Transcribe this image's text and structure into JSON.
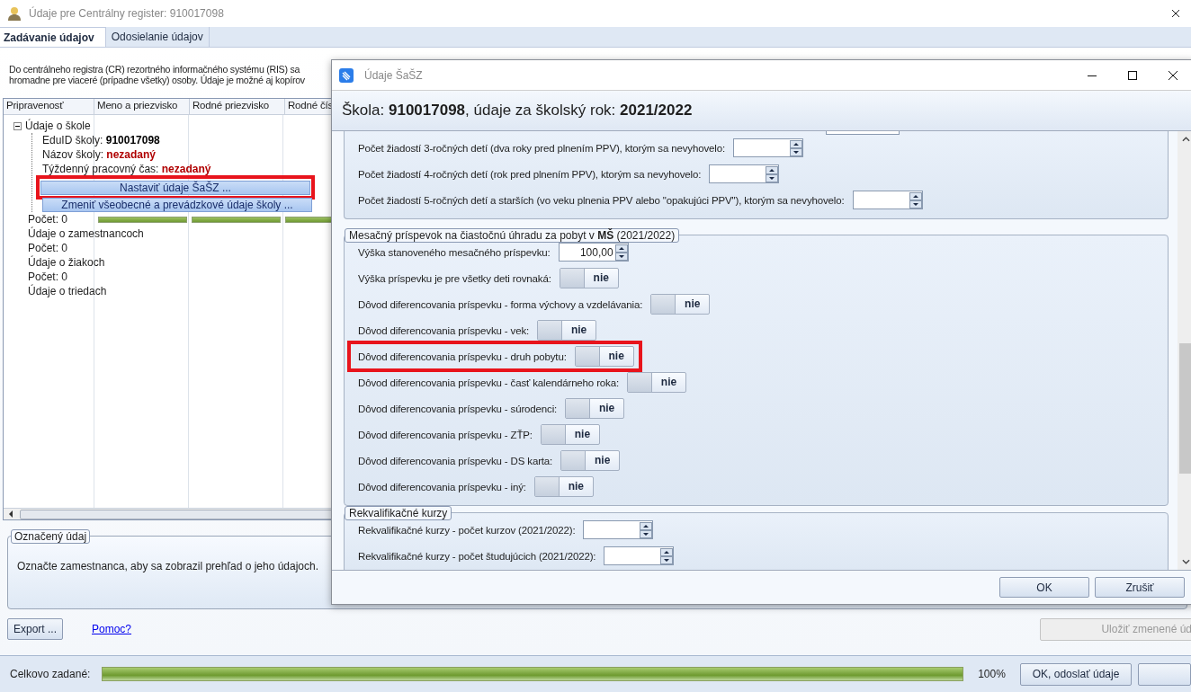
{
  "window": {
    "title": "Údaje pre Centrálny register: 910017098"
  },
  "tabs": [
    {
      "label": "Zadávanie údajov",
      "selected": true
    },
    {
      "label": "Odosielanie údajov",
      "selected": false
    }
  ],
  "description": [
    "Do centrálneho registra (CR) rezortného informačného systému (RIS) sa",
    "hromadne pre viaceré (prípadne všetky) osoby. Údaje je možné aj kopírov"
  ],
  "table": {
    "columns": [
      "Pripravenosť",
      "Meno a priezvisko",
      "Rodné priezvisko",
      "Rodné čís"
    ],
    "tree": {
      "label": "Údaje o škole",
      "expanded": true,
      "children": [
        {
          "kind": "value",
          "label": "EduID školy:",
          "value": "910017098",
          "missing": false
        },
        {
          "kind": "value",
          "label": "Názov školy:",
          "value": "nezadaný",
          "missing": true
        },
        {
          "kind": "value",
          "label": "Týždenný pracovný čas:",
          "value": "nezadaný",
          "missing": true
        },
        {
          "kind": "button",
          "label": "Nastaviť údaje ŠaŠZ ...",
          "highlighted": true
        },
        {
          "kind": "button",
          "label": "Zmeniť všeobecné a prevádzkové údaje školy ...",
          "highlighted": false
        }
      ]
    },
    "rows": [
      {
        "label": "Počet: 0",
        "bars": [
          {
            "level": 1
          },
          {
            "level": 1
          },
          {
            "level": 1
          }
        ]
      },
      {
        "label": "Údaje o zamestnancoch"
      },
      {
        "label": "Počet: 0"
      },
      {
        "label": "Údaje o žiakoch"
      },
      {
        "label": "Počet: 0"
      },
      {
        "label": "Údaje o triedach"
      }
    ]
  },
  "selected_info": {
    "title": "Označený údaj",
    "text": "Označte zamestnanca, aby sa zobrazil prehľad o jeho údajoch."
  },
  "export_button": "Export ...",
  "help_link": "Pomoc?",
  "save_button": {
    "label": "Uložiť zmenené úd",
    "disabled": true
  },
  "status_bar": {
    "label": "Celkovo zadané:",
    "level": 1,
    "reading": "100%",
    "button": "OK, odoslať údaje"
  },
  "dialog": {
    "title": "Údaje ŠaŠZ",
    "heading": "Škola: **910017098**, údaje za školský rok: **2021/2022**",
    "groups": [
      {
        "rows": [
          {
            "kind": "spinner",
            "label": "Počet žiadostí 3-ročných detí (dva roky pred plnením PPV), ktorým sa nevyhovelo:",
            "highlighted": false
          },
          {
            "kind": "spinner",
            "label": "Počet žiadostí 4-ročných detí (rok pred plnením PPV), ktorým sa nevyhovelo:",
            "highlighted": false
          },
          {
            "kind": "spinner",
            "label": "Počet žiadostí 5-ročných detí a starších (vo veku plnenia PPV alebo \"opakujúci PPV\"), ktorým sa nevyhovelo:",
            "highlighted": false
          }
        ]
      },
      {
        "legend": "Mesačný príspevok na čiastočnú úhradu za pobyt v **MŠ** (2021/2022)",
        "rows": [
          {
            "kind": "spinner",
            "label": "Výška stanoveného mesačného príspevku:",
            "value": "100,00",
            "highlighted": false
          },
          {
            "kind": "toggle",
            "label": "Výška príspevku je pre všetky deti rovnaká:",
            "on": false,
            "text": "nie",
            "highlighted": false
          },
          {
            "kind": "toggle",
            "label": "Dôvod diferencovania príspevku - forma výchovy a vzdelávania:",
            "on": false,
            "text": "nie",
            "highlighted": false
          },
          {
            "kind": "toggle",
            "label": "Dôvod diferencovania príspevku - vek:",
            "on": false,
            "text": "nie",
            "highlighted": false
          },
          {
            "kind": "toggle",
            "label": "Dôvod diferencovania príspevku - druh pobytu:",
            "on": false,
            "text": "nie",
            "highlighted": true
          },
          {
            "kind": "toggle",
            "label": "Dôvod diferencovania príspevku - časť kalendárneho roka:",
            "on": false,
            "text": "nie",
            "highlighted": false
          },
          {
            "kind": "toggle",
            "label": "Dôvod diferencovania príspevku - súrodenci:",
            "on": false,
            "text": "nie",
            "highlighted": false
          },
          {
            "kind": "toggle",
            "label": "Dôvod diferencovania príspevku - ZŤP:",
            "on": false,
            "text": "nie",
            "highlighted": false
          },
          {
            "kind": "toggle",
            "label": "Dôvod diferencovania príspevku - DS karta:",
            "on": false,
            "text": "nie",
            "highlighted": false
          },
          {
            "kind": "toggle",
            "label": "Dôvod diferencovania príspevku - iný:",
            "on": false,
            "text": "nie",
            "highlighted": false
          }
        ]
      },
      {
        "legend": "Rekvalifikačné kurzy",
        "rows": [
          {
            "kind": "spinner",
            "label": "Rekvalifikačné kurzy - počet kurzov (2021/2022):",
            "highlighted": false
          },
          {
            "kind": "spinner",
            "label": "Rekvalifikačné kurzy - počet študujúcich (2021/2022):",
            "highlighted": false
          }
        ]
      }
    ],
    "buttons": [
      "OK",
      "Zrušiť"
    ]
  }
}
